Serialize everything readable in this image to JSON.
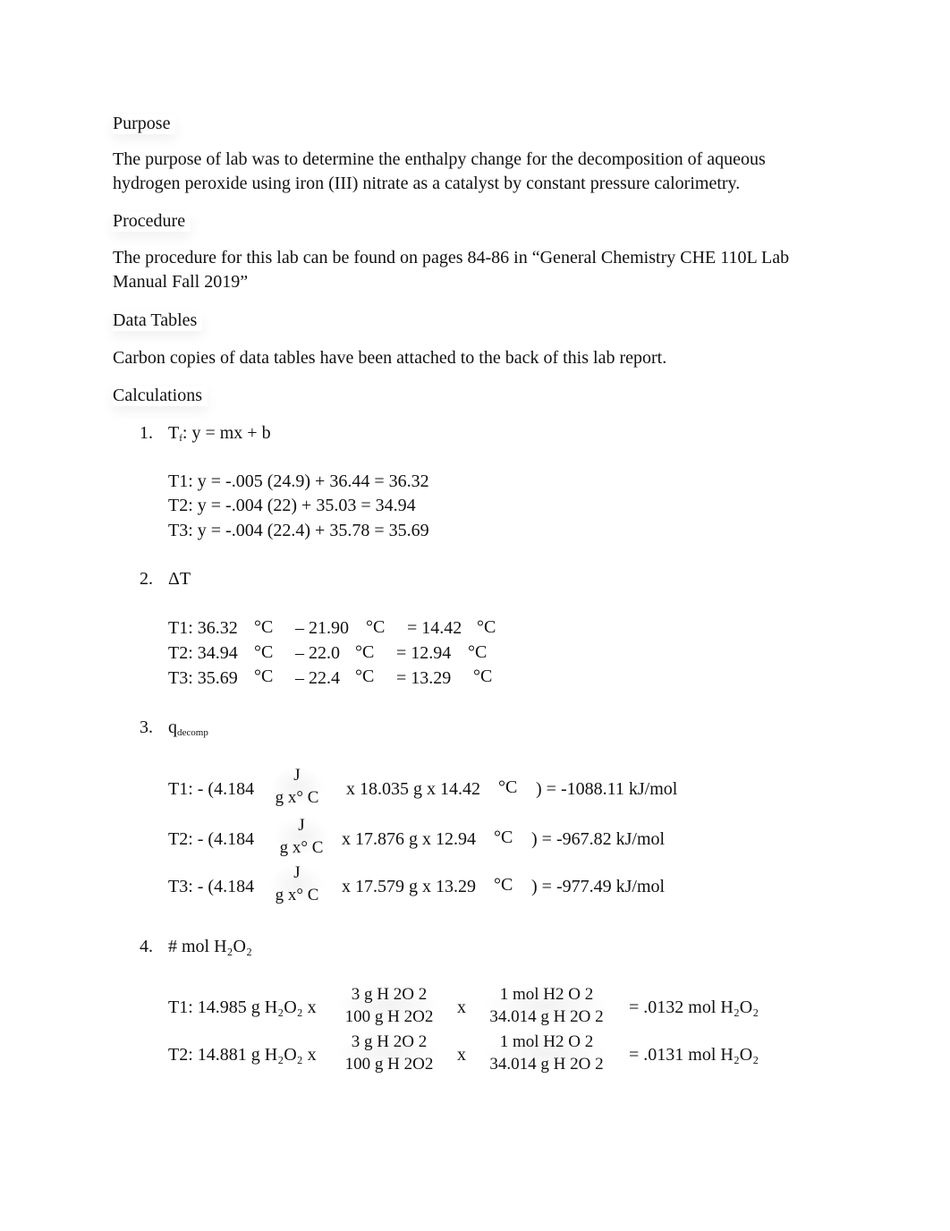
{
  "sections": {
    "purpose": {
      "heading": "Purpose",
      "body": "The purpose of lab was to determine the enthalpy change for the decomposition of aqueous hydrogen peroxide using iron (III) nitrate as a catalyst by constant pressure calorimetry."
    },
    "procedure": {
      "heading": "Procedure",
      "body": "The procedure for this lab can be found on pages 84-86 in “General Chemistry CHE 110L Lab Manual Fall 2019”"
    },
    "data_tables": {
      "heading": "Data Tables",
      "body": "Carbon copies of data tables have been attached to the back of this lab report."
    },
    "calculations": {
      "heading": "Calculations"
    }
  },
  "calc1": {
    "number": "1.",
    "title_main": "T",
    "title_sub": "f",
    "title_rest": ": y = mx + b",
    "lines": [
      "T1: y = -.005 (24.9) + 36.44 = 36.32",
      "T2: y = -.004 (22) + 35.03 = 34.94",
      "T3: y = -.004 (22.4) + 35.78 = 35.69"
    ]
  },
  "calc2": {
    "number": "2.",
    "title": "ΔT",
    "unit": "°C",
    "rows": [
      {
        "label": "T1: 36.32",
        "minus": "– 21.90",
        "result": "= 14.42"
      },
      {
        "label": "T2: 34.94",
        "minus": "– 22.0",
        "result": "= 12.94"
      },
      {
        "label": "T3: 35.69",
        "minus": "– 22.4",
        "result": "= 13.29"
      }
    ]
  },
  "calc3": {
    "number": "3.",
    "title_main": "q",
    "title_sub": "decomp",
    "frac_num": "J",
    "frac_den": "g x° C",
    "unit": "°C",
    "rows": [
      {
        "prefix": "T1: - (4.184",
        "middle": "x 18.035 g x 14.42",
        "result": ") = -1088.11 kJ/mol"
      },
      {
        "prefix": "T2: - (4.184",
        "middle": "x 17.876 g x 12.94",
        "result": ") = -967.82 kJ/mol"
      },
      {
        "prefix": "T3: - (4.184",
        "middle": "x 17.579 g x 13.29",
        "result": ") = -977.49 kJ/mol"
      }
    ]
  },
  "calc4": {
    "number": "4.",
    "title": "# mol H₂O₂",
    "times": "x",
    "frac1_num": "3 g H 2O 2",
    "frac1_den": "100 g H 2O2",
    "frac2_num": "1 mol H2 O 2",
    "frac2_den": "34.014 g H 2O 2",
    "rows": [
      {
        "prefix": "T1: 14.985 g H₂O₂ x",
        "result": "= .0132 mol H₂O₂"
      },
      {
        "prefix": "T2: 14.881 g H₂O₂ x",
        "result": "= .0131 mol H₂O₂"
      }
    ]
  }
}
